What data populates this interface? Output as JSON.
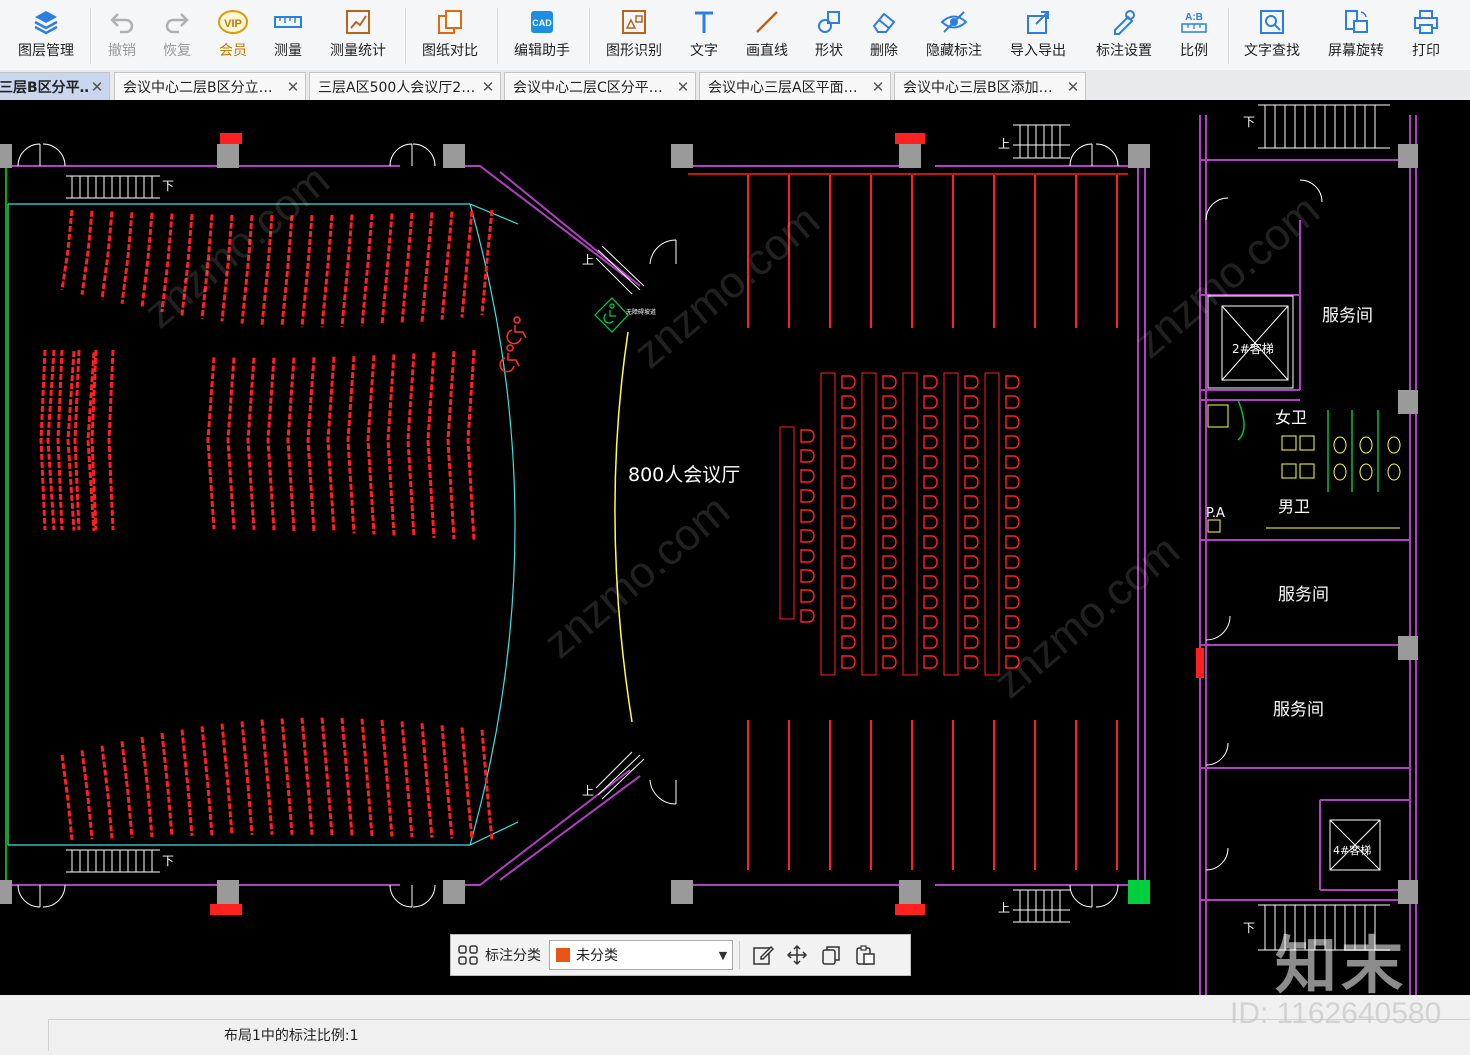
{
  "toolbar": {
    "items": [
      {
        "label": "图层管理",
        "icon": "layers-icon"
      },
      {
        "label": "撤销",
        "icon": "undo-icon"
      },
      {
        "label": "恢复",
        "icon": "redo-icon"
      },
      {
        "label": "会员",
        "icon": "vip-icon"
      },
      {
        "label": "测量",
        "icon": "measure-icon"
      },
      {
        "label": "测量统计",
        "icon": "measure-stats-icon"
      },
      {
        "label": "图纸对比",
        "icon": "compare-icon"
      },
      {
        "label": "编辑助手",
        "icon": "cad-edit-icon"
      },
      {
        "label": "图形识别",
        "icon": "shape-recognize-icon"
      },
      {
        "label": "文字",
        "icon": "text-icon"
      },
      {
        "label": "画直线",
        "icon": "line-icon"
      },
      {
        "label": "形状",
        "icon": "shape-icon"
      },
      {
        "label": "删除",
        "icon": "eraser-icon"
      },
      {
        "label": "隐藏标注",
        "icon": "hide-eye-icon"
      },
      {
        "label": "导入导出",
        "icon": "import-export-icon"
      },
      {
        "label": "标注设置",
        "icon": "annotation-settings-icon"
      },
      {
        "label": "比例",
        "icon": "scale-icon"
      },
      {
        "label": "文字查找",
        "icon": "text-search-icon"
      },
      {
        "label": "屏幕旋转",
        "icon": "rotate-screen-icon"
      },
      {
        "label": "打印",
        "icon": "print-icon"
      }
    ]
  },
  "tabs": [
    {
      "label": "三层B区分平…",
      "active": true
    },
    {
      "label": "会议中心二层B区分立…",
      "active": false
    },
    {
      "label": "三层A区500人会议厅2…",
      "active": false
    },
    {
      "label": "会议中心二层C区分平…",
      "active": false
    },
    {
      "label": "会议中心三层A区平面…",
      "active": false
    },
    {
      "label": "会议中心三层B区添加…",
      "active": false
    }
  ],
  "drawing": {
    "hall_label": "800人会议厅",
    "room_service_1": "服务间",
    "room_service_2": "服务间",
    "room_service_3": "服务间",
    "room_female_wc": "女卫",
    "room_male_wc": "男卫",
    "room_pa": "P.A",
    "elevator_2": "2#客梯",
    "elevator_4": "4#客梯",
    "stair_up": "上",
    "stair_down": "下",
    "accessible_label": "无障碍坡道",
    "layer_colors": {
      "seats": "#ff2020",
      "walls": "#b040c0",
      "stage_line": "#ffff40",
      "rows": "#40e0e0",
      "columns": "#9a9a9a",
      "text": "#ffffff",
      "green_mark": "#00d040"
    }
  },
  "float_toolbar": {
    "grid_icon": "grid-icon",
    "label": "标注分类",
    "select_value": "未分类",
    "swatch_color": "#e8541a",
    "actions": [
      "edit-icon",
      "move-icon",
      "copy-icon",
      "paste-icon"
    ]
  },
  "status": {
    "text": "布局1中的标注比例:1"
  },
  "watermark": {
    "logo": "知末",
    "id": "ID: 1162640580",
    "site": "znzmo.com"
  }
}
